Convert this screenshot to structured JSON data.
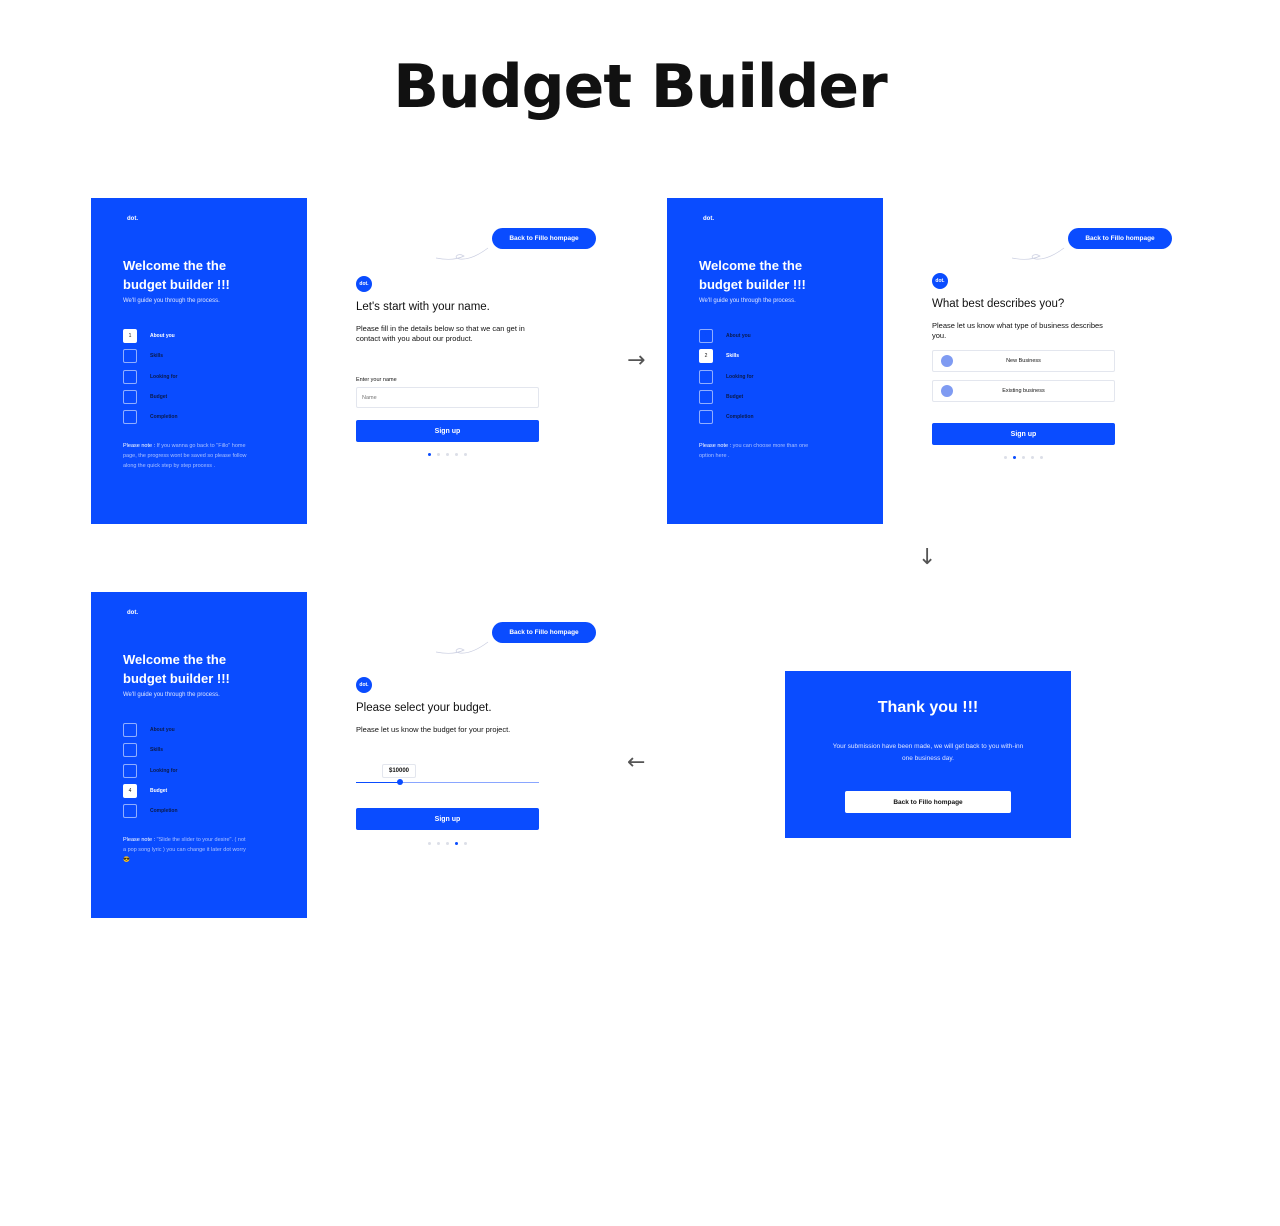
{
  "title": "Budget Builder",
  "brand_color": "#0A4CFF",
  "logo_text": "dot.",
  "welcome_title": "Welcome the the budget builder !!!",
  "welcome_sub": "We'll guide you through the process.",
  "steps": [
    "About you",
    "Skills",
    "Looking for",
    "Budget",
    "Completion"
  ],
  "back_label": "Back to Fillo hompage",
  "signup_label": "Sign up",
  "screen1": {
    "heading": "Let's start with your name.",
    "desc": "Please fill in the details below so that we can get in contact with you about our product.",
    "field_label": "Enter your name",
    "placeholder": "Name",
    "note_label": "Please note :",
    "note_text": " If you wanna go back to \"Fillo\" home page, the progress wont be saved so please follow along the quick step by step process ."
  },
  "screen2": {
    "heading": "What best describes you?",
    "desc": "Please let us know what type of business describes you.",
    "options": [
      "New Business",
      "Existing business"
    ],
    "note_label": "Please note :",
    "note_text": " you can choose more than one option here ."
  },
  "screen3": {
    "heading": "Please select your budget.",
    "desc": "Please let us know the budget for your project.",
    "slider_value": "$10000",
    "slider_fraction": 0.24,
    "note_label": "Please note :",
    "note_text": "  \"Slide the slider to your desire\". ( not a pop song lyric ) you can change it later dot worry 😎"
  },
  "thanks": {
    "title": "Thank you !!!",
    "text": "Your submission have been made, we will get back to you with-inn one business day.",
    "button": "Back to Fillo hompage"
  },
  "arrows": [
    "→",
    "↓",
    "←"
  ]
}
